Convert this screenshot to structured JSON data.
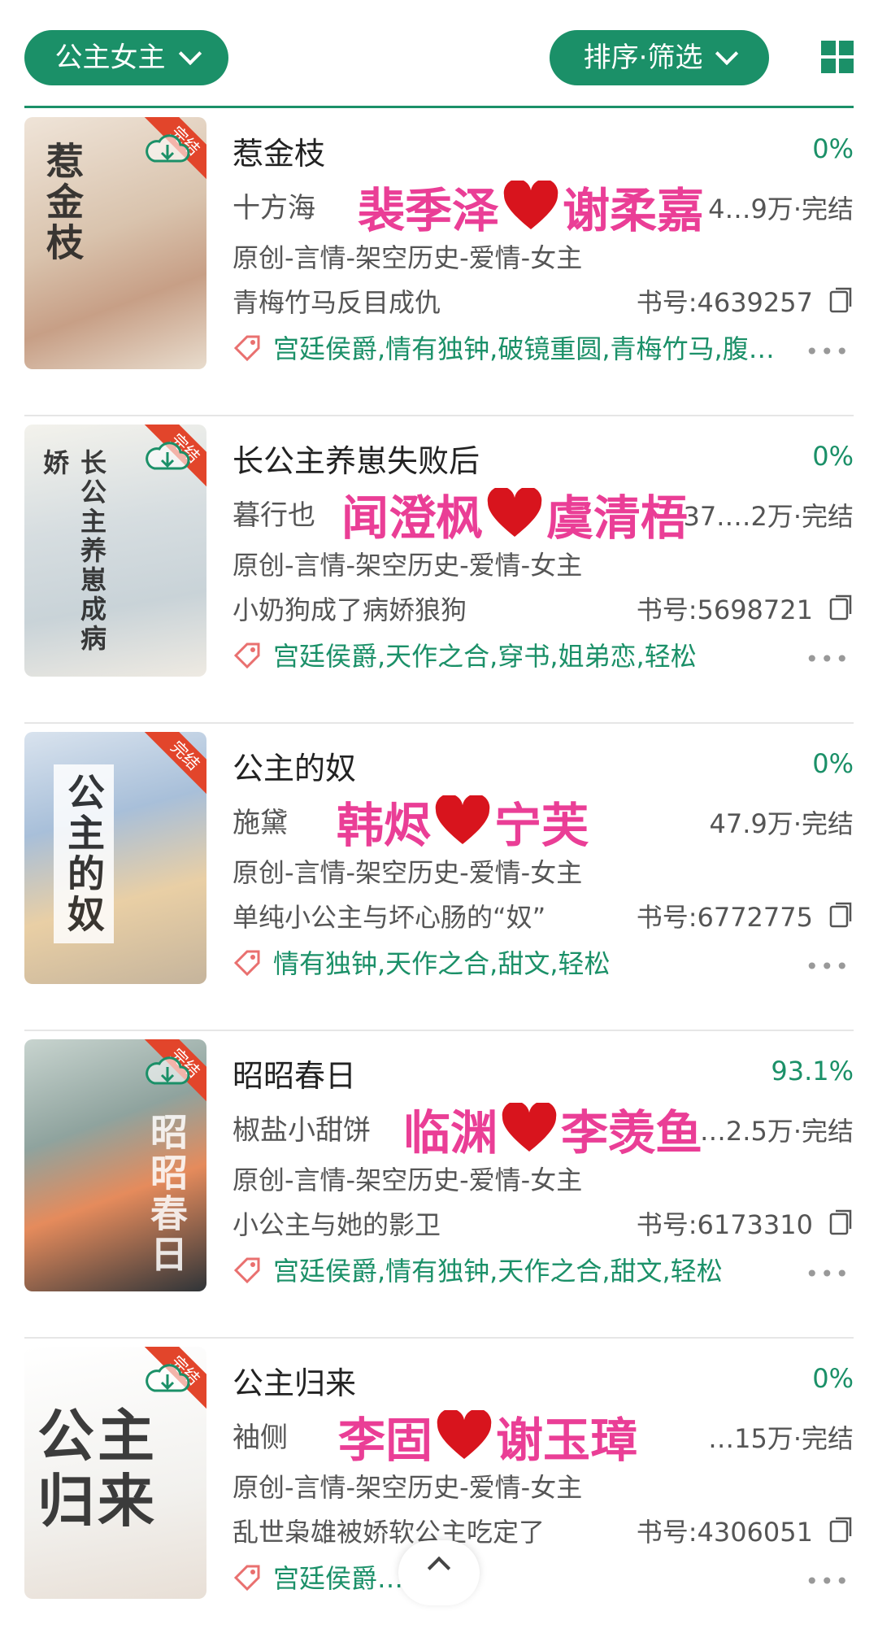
{
  "toolbar": {
    "category_label": "公主女主",
    "sort_label": "排序·筛选",
    "accent": "#1b9068"
  },
  "books": [
    {
      "title": "惹金枝",
      "progress": "0%",
      "author": "十方海",
      "words": "4…9万",
      "status": "·完结",
      "couple_a": "裴季泽",
      "couple_b": "谢柔嘉",
      "category": "原创-言情-架空历史-爱情-女主",
      "summary": "青梅竹马反目成仇",
      "book_no": "书号:4639257",
      "tags": "宫廷侯爵,情有独钟,破镜重圆,青梅竹马,腹…",
      "cover_title": "惹金枝",
      "ribbon": "完结"
    },
    {
      "title": "长公主养崽失败后",
      "progress": "0%",
      "author": "暮行也",
      "words": "37.…2万",
      "status": "·完结",
      "couple_a": "闻澄枫",
      "couple_b": "虞清梧",
      "category": "原创-言情-架空历史-爱情-女主",
      "summary": "小奶狗成了病娇狼狗",
      "book_no": "书号:5698721",
      "tags": "宫廷侯爵,天作之合,穿书,姐弟恋,轻松",
      "cover_title": "长公主养崽成病娇",
      "ribbon": "完结"
    },
    {
      "title": "公主的奴",
      "progress": "0%",
      "author": "施黛",
      "words": "47.9万",
      "status": "·完结",
      "couple_a": "韩烬",
      "couple_b": "宁芙",
      "category": "原创-言情-架空历史-爱情-女主",
      "summary": "单纯小公主与坏心肠的“奴”",
      "book_no": "书号:6772775",
      "tags": "情有独钟,天作之合,甜文,轻松",
      "cover_title": "公主的奴",
      "ribbon": "完结"
    },
    {
      "title": "昭昭春日",
      "progress": "93.1%",
      "author": "椒盐小甜饼",
      "words": "…2.5万",
      "status": "·完结",
      "couple_a": "临渊",
      "couple_b": "李羡鱼",
      "category": "原创-言情-架空历史-爱情-女主",
      "summary": "小公主与她的影卫",
      "book_no": "书号:6173310",
      "tags": "宫廷侯爵,情有独钟,天作之合,甜文,轻松",
      "cover_title": "昭昭春日",
      "ribbon": "完结"
    },
    {
      "title": "公主归来",
      "progress": "0%",
      "author": "袖侧",
      "words": "…15万",
      "status": "·完结",
      "couple_a": "李固",
      "couple_b": "谢玉璋",
      "category": "原创-言情-架空历史-爱情-女主",
      "summary": "乱世枭雄被娇软公主吃定了",
      "book_no": "书号:4306051",
      "tags": "宫廷侯爵…正剧",
      "cover_title": "公主归来",
      "ribbon": "完结"
    }
  ]
}
